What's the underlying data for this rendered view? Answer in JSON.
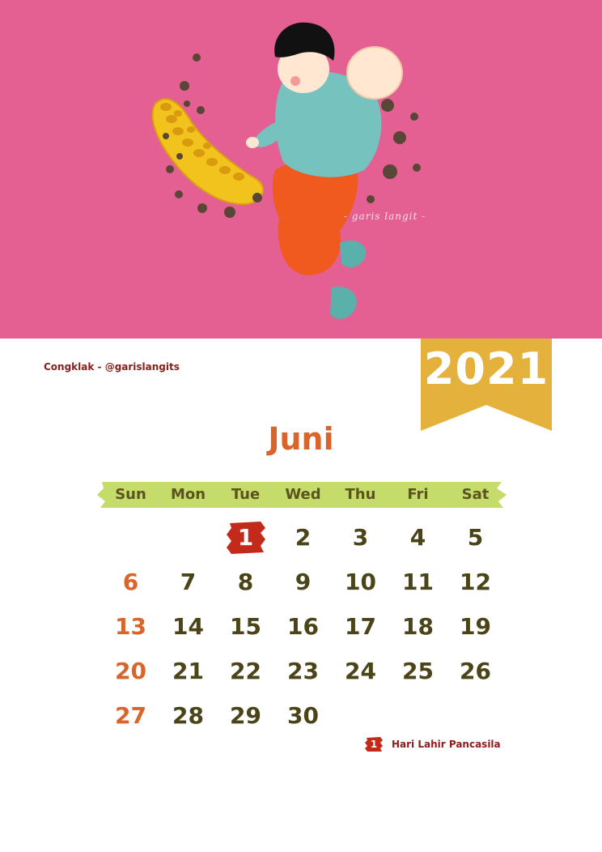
{
  "colors": {
    "hero_bg": "#e45f92",
    "ribbon": "#e4b23c",
    "weekbar": "#c5dc6a",
    "month_text": "#d9652b",
    "holiday_mark": "#c32a1a",
    "date_text": "#4a4418",
    "sunday_text": "#d9652b"
  },
  "illustration": {
    "watermark": "- garis langit -",
    "subject": "Congklak"
  },
  "caption": "Congklak - @garislangits",
  "year": "2021",
  "month": "Juni",
  "weekdays": [
    "Sun",
    "Mon",
    "Tue",
    "Wed",
    "Thu",
    "Fri",
    "Sat"
  ],
  "dates": [
    [
      "",
      "",
      "1",
      "2",
      "3",
      "4",
      "5"
    ],
    [
      "6",
      "7",
      "8",
      "9",
      "10",
      "11",
      "12"
    ],
    [
      "13",
      "14",
      "15",
      "16",
      "17",
      "18",
      "19"
    ],
    [
      "20",
      "21",
      "22",
      "23",
      "24",
      "25",
      "26"
    ],
    [
      "27",
      "28",
      "29",
      "30",
      "",
      "",
      ""
    ]
  ],
  "holidays": [
    {
      "date": "1",
      "label": "Hari Lahir Pancasila"
    }
  ]
}
